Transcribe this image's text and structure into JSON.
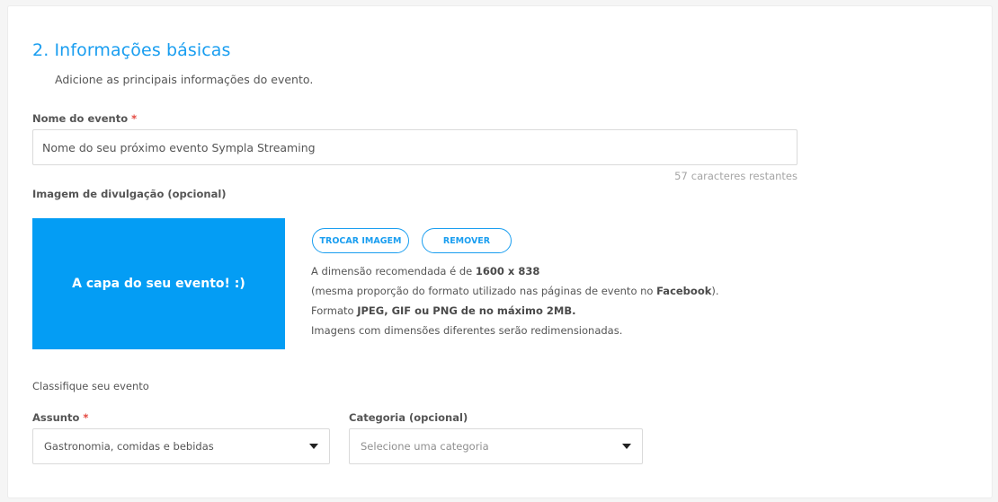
{
  "section": {
    "title": "2. Informações básicas",
    "subtitle": "Adicione as principais informações do evento."
  },
  "event_name": {
    "label": "Nome do evento",
    "required_mark": "*",
    "value": "Nome do seu próximo evento Sympla Streaming",
    "counter_number": "57",
    "counter_text": "caracteres restantes"
  },
  "image": {
    "label": "Imagem de divulgação (opcional)",
    "cover_text": "A capa do seu evento! :)",
    "cover_color": "#049df4",
    "swap_button": "TROCAR IMAGEM",
    "remove_button": "REMOVER",
    "hint1_pre": "A dimensão recomendada é de ",
    "hint1_bold": "1600 x 838",
    "hint2_pre": "(mesma proporção do formato utilizado nas páginas de evento no ",
    "hint2_bold": "Facebook",
    "hint2_post": ").",
    "hint3_pre": "Formato ",
    "hint3_bold": "JPEG, GIF ou PNG de no máximo 2MB.",
    "hint4": "Imagens com dimensões diferentes serão redimensionadas."
  },
  "classify": {
    "heading": "Classifique seu evento",
    "subject_label": "Assunto",
    "subject_required": "*",
    "subject_value": "Gastronomia, comidas e bebidas",
    "category_label": "Categoria (opcional)",
    "category_placeholder": "Selecione uma categoria",
    "caret_icon": "caret-down-icon"
  },
  "colors": {
    "accent": "#1a9ef0",
    "required": "#e4473f"
  }
}
